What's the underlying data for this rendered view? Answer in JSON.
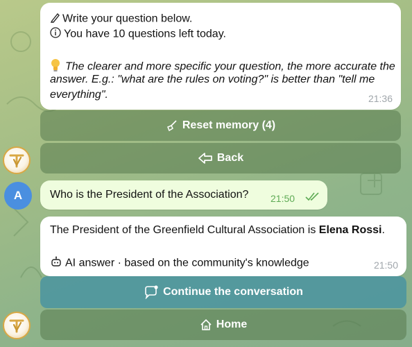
{
  "bot_message_1": {
    "line1": "Write your question below.",
    "line2": "You have 10 questions left today.",
    "tip_line1": "The clearer and more specific your question, the more accurate the",
    "tip_line2": "answer. E.g.: \"what are the rules on voting?\" is better than \"tell me",
    "tip_line3": "everything\".",
    "time": "21:36",
    "icons": [
      "pencil-icon",
      "info-icon",
      "lightbulb-icon"
    ]
  },
  "keyboard_1": {
    "reset_label": "Reset memory (4)",
    "back_label": "Back"
  },
  "user_message": {
    "avatar_letter": "A",
    "text": "Who is the President of the Association?",
    "time": "21:50",
    "status": "read"
  },
  "bot_message_2": {
    "text_before": "The President of the Greenfield Cultural Association is ",
    "text_bold": "Elena Rossi",
    "text_after": ".",
    "footer": "AI answer · based on the community's knowledge",
    "time": "21:50"
  },
  "keyboard_2": {
    "continue_label": "Continue the conversation",
    "home_label": "Home"
  },
  "colors": {
    "primary_button": "#4a94a0",
    "check_green": "#5fab56",
    "avatar_blue": "#4a8fe0",
    "bot_gold": "#d9a844"
  }
}
